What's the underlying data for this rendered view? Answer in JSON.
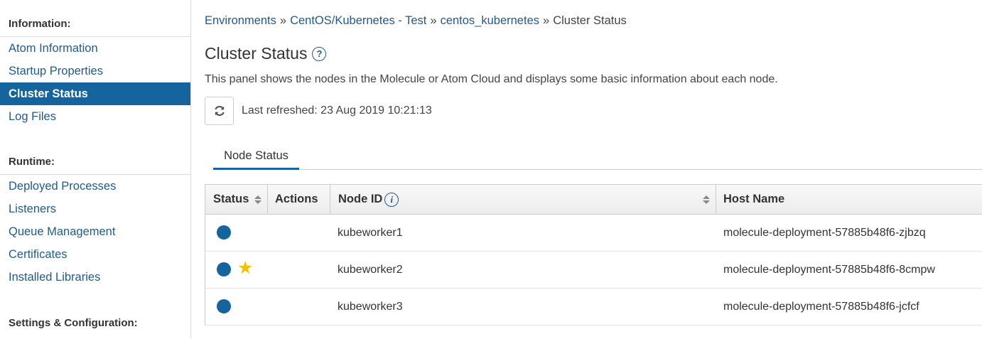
{
  "sidebar": {
    "information": {
      "heading": "Information:",
      "items": [
        "Atom Information",
        "Startup Properties",
        "Cluster Status",
        "Log Files"
      ],
      "active": "Cluster Status"
    },
    "runtime": {
      "heading": "Runtime:",
      "items": [
        "Deployed Processes",
        "Listeners",
        "Queue Management",
        "Certificates",
        "Installed Libraries"
      ]
    },
    "settings": {
      "heading": "Settings & Configuration:"
    }
  },
  "breadcrumb": {
    "items": [
      "Environments",
      "CentOS/Kubernetes - Test",
      "centos_kubernetes"
    ],
    "separator": "»",
    "current": "Cluster Status"
  },
  "page": {
    "title": "Cluster Status",
    "help_icon": "question-circle-icon",
    "description": "This panel shows the nodes in the Molecule or Atom Cloud and displays some basic information about each node.",
    "refresh_icon": "refresh-icon",
    "last_refreshed": "Last refreshed: 23 Aug 2019 10:21:13"
  },
  "tabs": {
    "node_status": "Node Status"
  },
  "table": {
    "headers": {
      "status": "Status",
      "actions": "Actions",
      "node_id": "Node ID",
      "host_name": "Host Name"
    },
    "rows": [
      {
        "status": "running",
        "head_node": false,
        "node_id": "kubeworker1",
        "host_name": "molecule-deployment-57885b48f6-zjbzq"
      },
      {
        "status": "running",
        "head_node": true,
        "node_id": "kubeworker2",
        "host_name": "molecule-deployment-57885b48f6-8cmpw"
      },
      {
        "status": "running",
        "head_node": false,
        "node_id": "kubeworker3",
        "host_name": "molecule-deployment-57885b48f6-jcfcf"
      }
    ]
  },
  "colors": {
    "accent": "#15649e",
    "link": "#235a8c",
    "star": "#f2c200"
  }
}
